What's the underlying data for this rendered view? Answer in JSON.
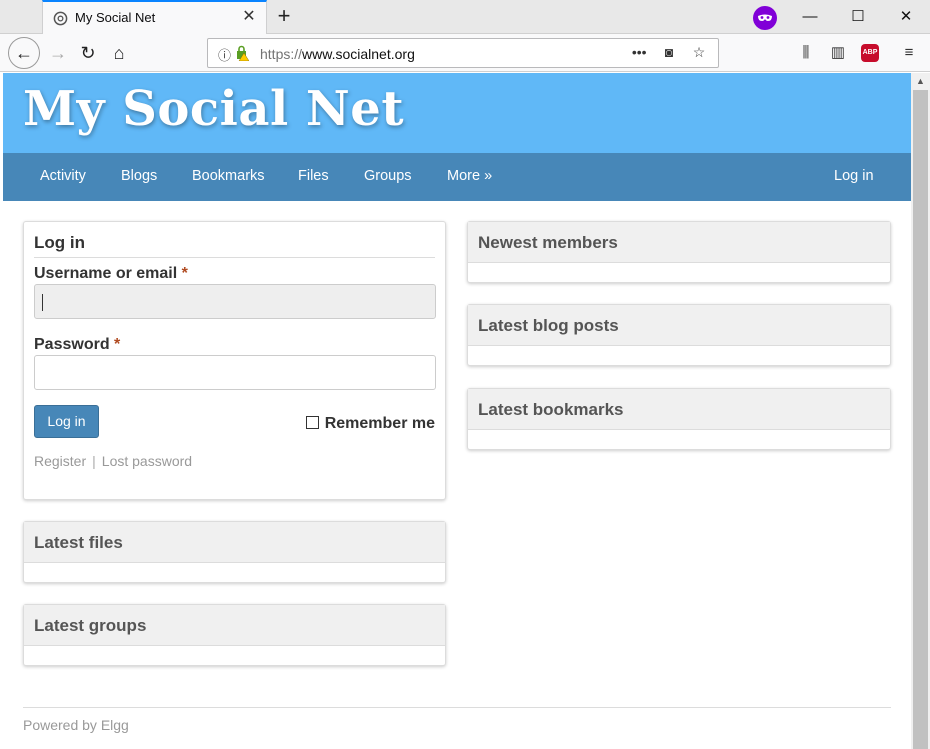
{
  "browser": {
    "tab_title": "My Social Net",
    "url_scheme": "https://",
    "url_host": "www.socialnet.org"
  },
  "site": {
    "title": "My Social Net",
    "nav": [
      "Activity",
      "Blogs",
      "Bookmarks",
      "Files",
      "Groups",
      "More »"
    ],
    "login_link": "Log in"
  },
  "login": {
    "title": "Log in",
    "username_label": "Username or email",
    "password_label": "Password",
    "required_marker": "*",
    "submit_label": "Log in",
    "remember_label": "Remember me",
    "register_link": "Register",
    "separator": "|",
    "lost_password_link": "Lost password"
  },
  "left_modules": [
    "Latest files",
    "Latest groups"
  ],
  "right_modules": [
    "Newest members",
    "Latest blog posts",
    "Latest bookmarks"
  ],
  "footer": {
    "powered_by": "Powered by Elgg"
  },
  "colors": {
    "header_bg": "#60b8f7",
    "nav_bg": "#4787b8",
    "button_bg": "#4787b8",
    "private_mask": "#8000d7"
  }
}
